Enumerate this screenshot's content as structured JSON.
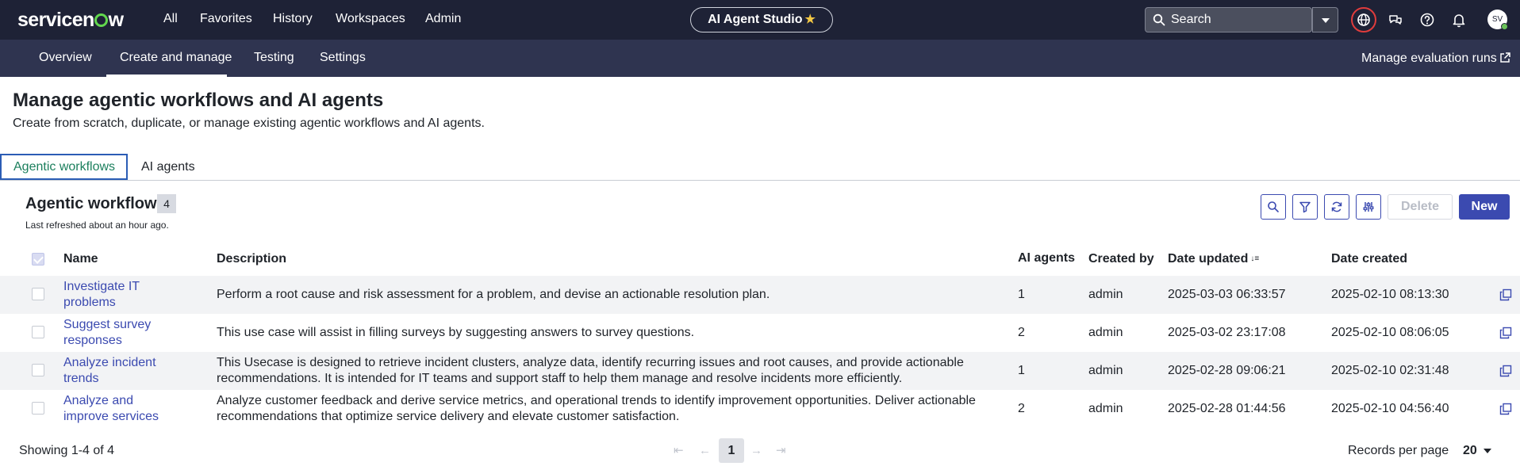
{
  "brand": {
    "logo_text_before": "servicen",
    "logo_text_after": "w"
  },
  "top_nav": {
    "items": [
      "All",
      "Favorites",
      "History",
      "Workspaces",
      "Admin"
    ],
    "app_title": "AI Agent Studio",
    "search_placeholder": "Search",
    "avatar_initials": "SV"
  },
  "sub_nav": {
    "items": [
      "Overview",
      "Create and manage",
      "Testing",
      "Settings"
    ],
    "active": "Create and manage",
    "manage_runs": "Manage evaluation runs"
  },
  "page": {
    "title": "Manage agentic workflows and AI agents",
    "subtitle": "Create from scratch, duplicate, or manage existing agentic workflows and AI agents."
  },
  "tabs": [
    {
      "label": "Agentic workflows",
      "active": true
    },
    {
      "label": "AI agents",
      "active": false
    }
  ],
  "list": {
    "title": "Agentic workflows",
    "count": "4",
    "refreshed": "Last refreshed about an hour ago.",
    "delete_label": "Delete",
    "new_label": "New",
    "columns": [
      "Name",
      "Description",
      "AI agents",
      "Created by",
      "Date updated",
      "Date created"
    ],
    "rows": [
      {
        "name": "Investigate IT problems",
        "description": "Perform a root cause and risk assessment for a problem, and devise an actionable resolution plan.",
        "agents": "1",
        "created_by": "admin",
        "date_updated": "2025-03-03 06:33:57",
        "date_created": "2025-02-10 08:13:30"
      },
      {
        "name": "Suggest survey responses",
        "description": "This use case will assist in filling surveys by suggesting answers to survey questions.",
        "agents": "2",
        "created_by": "admin",
        "date_updated": "2025-03-02 23:17:08",
        "date_created": "2025-02-10 08:06:05"
      },
      {
        "name": "Analyze incident trends",
        "description": "This Usecase is designed to retrieve incident clusters, analyze data, identify recurring issues and root causes, and provide actionable recommendations. It is intended for IT teams and support staff to help them manage and resolve incidents more efficiently.",
        "agents": "1",
        "created_by": "admin",
        "date_updated": "2025-02-28 09:06:21",
        "date_created": "2025-02-10 02:31:48"
      },
      {
        "name": "Analyze and improve services",
        "description": "Analyze customer feedback and derive service metrics, and operational trends to identify improvement opportunities. Deliver actionable recommendations that optimize service delivery and elevate customer satisfaction.",
        "agents": "2",
        "created_by": "admin",
        "date_updated": "2025-02-28 01:44:56",
        "date_created": "2025-02-10 04:56:40"
      }
    ]
  },
  "footer": {
    "showing": "Showing 1-4 of 4",
    "current_page": "1",
    "records_per_page_label": "Records per page",
    "records_per_page_value": "20"
  },
  "colors": {
    "header_bg": "#1e2236",
    "subnav_bg": "#2f3450",
    "accent": "#3b4ab0",
    "active_tab_text": "#1b7f5d",
    "logo_green": "#62d84e",
    "alert_ring": "#e03c3c"
  },
  "icons": [
    "search-icon",
    "globe-icon",
    "chat-icon",
    "help-icon",
    "bell-icon",
    "external-link-icon",
    "filter-icon",
    "refresh-icon",
    "settings-sliders-icon",
    "copy-icon",
    "star-icon",
    "sort-desc-icon"
  ]
}
